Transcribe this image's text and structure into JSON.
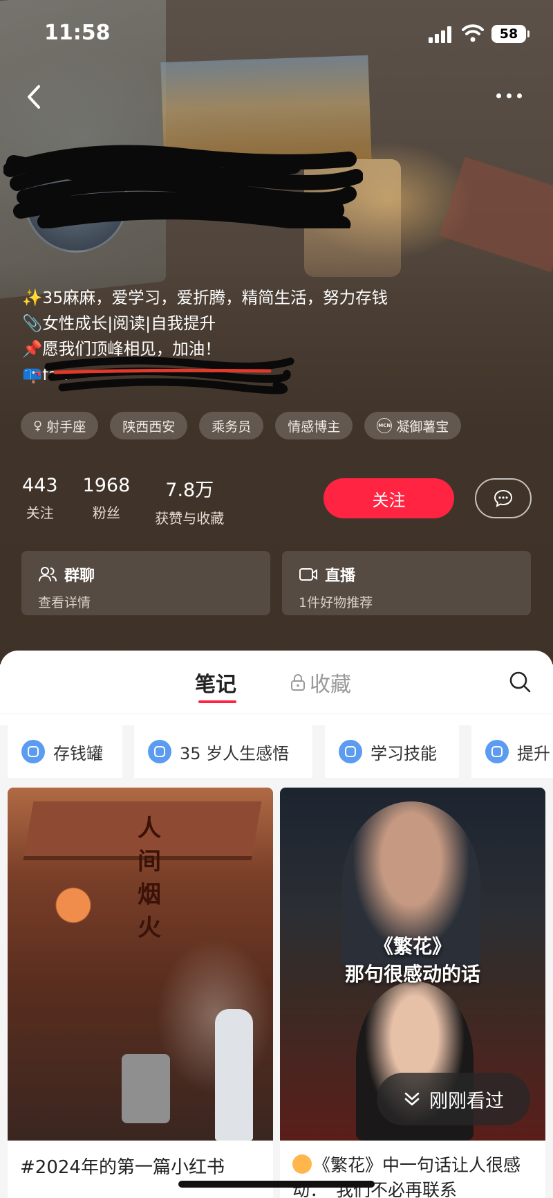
{
  "status_bar": {
    "time": "11:58",
    "battery": "58"
  },
  "profile": {
    "bio_lines": [
      "✨35麻麻，爱学习，爱折腾，精简生活，努力存钱",
      "📎女性成长|阅读|自我提升",
      "📌愿我们顶峰相见，加油！",
      "📪fan"
    ],
    "tags": [
      {
        "icon": "female-icon",
        "label": "射手座"
      },
      {
        "icon": "",
        "label": "陕西西安"
      },
      {
        "icon": "",
        "label": "乘务员"
      },
      {
        "icon": "",
        "label": "情感博主"
      },
      {
        "icon": "mcn-icon",
        "badge": "MCN",
        "label": "凝御薯宝"
      }
    ],
    "stats": [
      {
        "value": "443",
        "label": "关注"
      },
      {
        "value": "1968",
        "label": "粉丝"
      },
      {
        "value": "7.8万",
        "label": "获赞与收藏"
      }
    ],
    "follow_label": "关注",
    "cards": [
      {
        "icon": "group-icon",
        "title": "群聊",
        "subtitle": "查看详情"
      },
      {
        "icon": "live-icon",
        "title": "直播",
        "subtitle": "1件好物推荐"
      }
    ]
  },
  "tabs": {
    "notes": "笔记",
    "favorites": "收藏"
  },
  "collections": [
    "存钱罐",
    "35 岁人生感悟",
    "学习技能",
    "提升"
  ],
  "notes": [
    {
      "image_text": "人间烟火",
      "title": "#2024年的第一篇小红书"
    },
    {
      "overlay_title_1": "《繁花》",
      "overlay_title_2": "那句很感动的话",
      "title": "《繁花》中一句话让人很感动：“我们不必再联系"
    }
  ],
  "recently_viewed": "刚刚看过",
  "colors": {
    "accent": "#ff2442",
    "collection_icon": "#5b9bf0"
  }
}
